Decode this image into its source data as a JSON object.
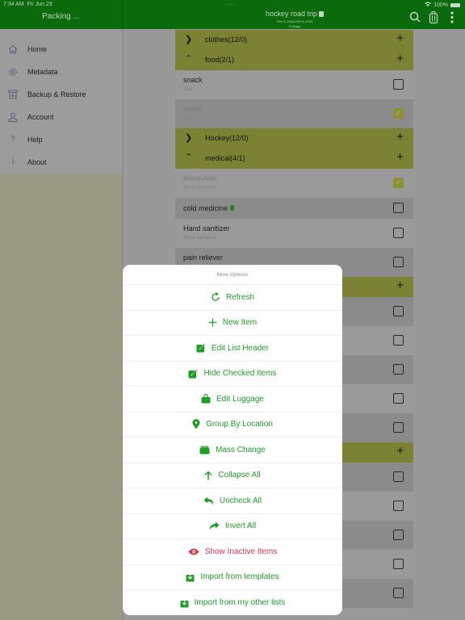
{
  "status_bar": {
    "time": "7:34 AM",
    "date": "Fri Jun 23",
    "battery": "100%"
  },
  "left_header": {
    "title": "Packing ..."
  },
  "list_header": {
    "title": "hockey road trip",
    "dates": "Feb 3, 2023-Feb 5, 2023",
    "location": "Chicago",
    "icons": [
      "search-icon",
      "luggage-icon",
      "more-vertical-icon"
    ]
  },
  "sidebar": {
    "items": [
      {
        "label": "Home",
        "icon": "home-icon"
      },
      {
        "label": "Metadata",
        "icon": "gear-icon"
      },
      {
        "label": "Backup & Restore",
        "icon": "archive-icon"
      },
      {
        "label": "Account",
        "icon": "person-icon"
      },
      {
        "label": "Help",
        "icon": "question-icon"
      },
      {
        "label": "About",
        "icon": "info-icon"
      }
    ]
  },
  "list": {
    "sections": [
      {
        "label": "clothes(12/0)",
        "expanded": false,
        "items": []
      },
      {
        "label": "food(2/1)",
        "expanded": true,
        "items": [
          {
            "name": "snack",
            "location": "Tote",
            "checked": false
          },
          {
            "name": "water",
            "location": "Tote",
            "checked": true
          }
        ]
      },
      {
        "label": "Hockey(12/0)",
        "expanded": false,
        "items": []
      },
      {
        "label": "medical(4/1)",
        "expanded": true,
        "items": [
          {
            "name": "Band-Aids",
            "location": "Black backpack",
            "checked": true
          },
          {
            "name": "cold medicine",
            "location": "",
            "checked": false,
            "has_bag_icon": true
          },
          {
            "name": "Hand sanitizer",
            "location": "Black backpack",
            "checked": false
          },
          {
            "name": "pain reliever",
            "location": "",
            "checked": false
          }
        ]
      }
    ]
  },
  "sheet": {
    "title": "More Options",
    "options": [
      {
        "label": "Refresh",
        "icon": "refresh-icon"
      },
      {
        "label": "New Item",
        "icon": "plus-icon"
      },
      {
        "label": "Edit List Header",
        "icon": "edit-icon"
      },
      {
        "label": "Hide Checked Items",
        "icon": "edit-icon"
      },
      {
        "label": "Edit Luggage",
        "icon": "bag-icon"
      },
      {
        "label": "Group By Location",
        "icon": "location-pin-icon"
      },
      {
        "label": "Mass Change",
        "icon": "stack-icon"
      },
      {
        "label": "Collapse All",
        "icon": "arrow-up-icon"
      },
      {
        "label": "Uncheck All",
        "icon": "reply-icon"
      },
      {
        "label": "Invert All",
        "icon": "forward-icon"
      },
      {
        "label": "Show Inactive Items",
        "icon": "eye-icon",
        "style": "danger"
      },
      {
        "label": "Import from templates",
        "icon": "import-icon"
      },
      {
        "label": "Import from my other lists",
        "icon": "import-icon"
      }
    ]
  },
  "colors": {
    "nav_green": "#0b6a0b",
    "section_header": "#7c8234",
    "action_green": "#1f9e26",
    "danger_red": "#e0344b"
  }
}
